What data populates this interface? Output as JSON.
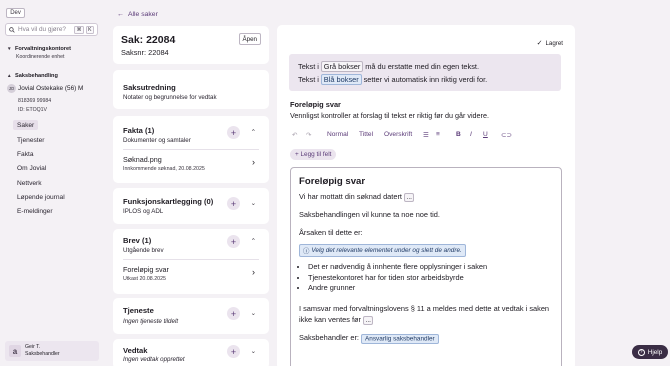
{
  "sidebar": {
    "env_badge": "Dev",
    "search": {
      "placeholder": "Hva vil du gjøre?",
      "kbd": [
        "⌘",
        "K"
      ]
    },
    "section_admin": {
      "title": "Forvaltningskontoret",
      "subtitle": "Koordinerende enhet"
    },
    "section_case": {
      "title": "Saksbehandling"
    },
    "person": {
      "initials": "JO",
      "name": "Jovial Ostekake (56) M",
      "id_number": "818369 99984",
      "short_id": "ID: ETOQ1V"
    },
    "nav": [
      {
        "label": "Saker",
        "active": true
      },
      {
        "label": "Tjenester",
        "active": false
      },
      {
        "label": "Fakta",
        "active": false
      },
      {
        "label": "Om Jovial",
        "active": false
      },
      {
        "label": "Nettverk",
        "active": false
      },
      {
        "label": "Løpende journal",
        "active": false
      },
      {
        "label": "E-meldinger",
        "active": false
      }
    ],
    "user": {
      "icon_letter": "a",
      "name": "Geir T.",
      "role": "Saksbehandler"
    }
  },
  "back_link": "Alle saker",
  "case": {
    "title": "Sak: 22084",
    "number": "Saksnr: 22084",
    "status": "Åpen"
  },
  "sections": {
    "utredning": {
      "title": "Saksutredning",
      "subtitle": "Notater og begrunnelse for vedtak"
    },
    "fakta": {
      "title": "Fakta (1)",
      "subtitle": "Dokumenter og samtaler",
      "item": {
        "title": "Søknad.png",
        "meta": "Innkommende søknad, 20.08.2025"
      }
    },
    "funksjon": {
      "title": "Funksjonskartlegging (0)",
      "subtitle": "IPLOS og ADL"
    },
    "brev": {
      "title": "Brev (1)",
      "subtitle": "Utgående brev",
      "item": {
        "title": "Foreløpig svar",
        "meta": "Utkast 20.08.2025"
      }
    },
    "tjeneste": {
      "title": "Tjeneste",
      "subtitle": "Ingen tjeneste tildelt"
    },
    "vedtak": {
      "title": "Vedtak",
      "subtitle": "Ingen vedtak opprettet"
    }
  },
  "editor": {
    "saved_label": "Lagret",
    "info_line1": {
      "pre": "Tekst i ",
      "tag": "Grå bokser",
      "post": " må du erstatte med din egen tekst."
    },
    "info_line2": {
      "pre": "Tekst i ",
      "tag": "Blå bokser",
      "post": " setter vi automatisk inn riktig verdi for."
    },
    "title": "Foreløpig svar",
    "subtitle": "Vennligst kontroller at forslag til tekst er riktig før du går videre.",
    "toolbar": {
      "normal": "Normal",
      "tittel": "Tittel",
      "overskrift": "Overskrift"
    },
    "add_field": "+ Legg til felt",
    "doc": {
      "heading": "Foreløpig svar",
      "p1": "Vi har mottatt din søknad datert",
      "slot": "...",
      "p2": "Saksbehandlingen vil kunne ta noe noe tid.",
      "p3": "Årsaken til dette er:",
      "choose": "Velg det relevante elementet under og slett de andre.",
      "bullets": [
        "Det er nødvendig å innhente flere opplysninger i saken",
        "Tjenestekontoret har for tiden stor arbeidsbyrde",
        "Andre grunner"
      ],
      "p4_line1": "I samsvar med forvaltningslovens § 11 a meldes med dette at vedtak i saken",
      "p4_line2": "ikke kan ventes før",
      "p5": "Saksbehandler er:",
      "signer_tag": "Ansvarlig saksbehandler"
    }
  },
  "help_label": "Hjelp"
}
